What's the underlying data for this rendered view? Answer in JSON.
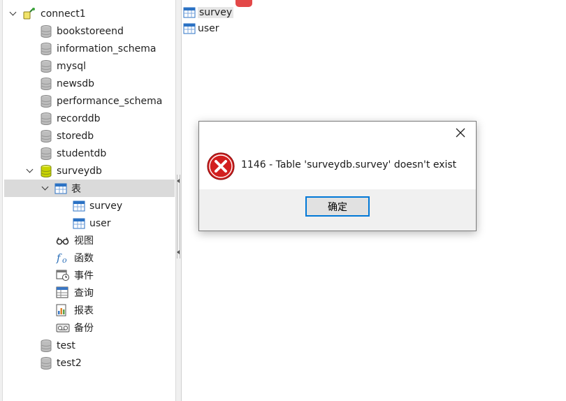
{
  "tree": {
    "connection": {
      "label": "connect1",
      "icon": "connection-icon"
    },
    "databases": [
      {
        "label": "bookstoreend",
        "icon": "database-icon"
      },
      {
        "label": "information_schema",
        "icon": "database-icon"
      },
      {
        "label": "mysql",
        "icon": "database-icon"
      },
      {
        "label": "newsdb",
        "icon": "database-icon"
      },
      {
        "label": "performance_schema",
        "icon": "database-icon"
      },
      {
        "label": "recorddb",
        "icon": "database-icon"
      },
      {
        "label": "storedb",
        "icon": "database-icon"
      },
      {
        "label": "studentdb",
        "icon": "database-icon"
      },
      {
        "label": "surveydb",
        "icon": "database-open-icon"
      },
      {
        "label": "test",
        "icon": "database-icon"
      },
      {
        "label": "test2",
        "icon": "database-icon"
      }
    ],
    "surveydb_children": {
      "tables_label": "表",
      "tables": [
        "survey",
        "user"
      ],
      "views_label": "视图",
      "functions_label": "函数",
      "events_label": "事件",
      "queries_label": "查询",
      "reports_label": "报表",
      "backups_label": "备份"
    }
  },
  "object_list": {
    "items": [
      "survey",
      "user"
    ],
    "selected": "survey"
  },
  "dialog": {
    "message": "1146 - Table 'surveydb.survey' doesn't exist",
    "ok_label": "确定"
  },
  "colors": {
    "selection": "#dadada",
    "error_red": "#d21f1f",
    "button_focus": "#0078d7",
    "table_icon": "#2b72c4",
    "db_open": "#c9d400"
  }
}
